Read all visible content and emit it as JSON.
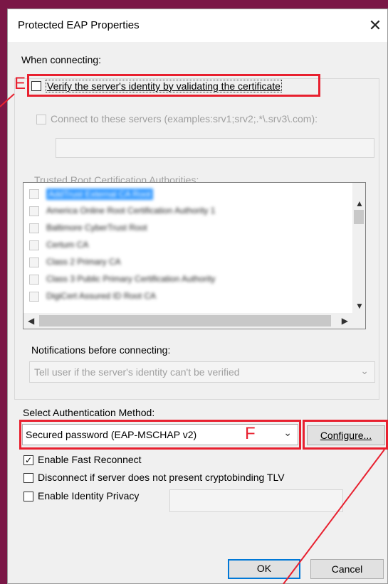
{
  "window": {
    "title": "Protected EAP Properties",
    "close_glyph": "✕"
  },
  "section_connecting": "When connecting:",
  "verify_server": {
    "label": "Verify the server's identity by validating the certificate",
    "checked": false
  },
  "connect_servers": {
    "label": "Connect to these servers (examples:srv1;srv2;.*\\.srv3\\.com):",
    "value": ""
  },
  "trusted_root_label": "Trusted Root Certification Authorities:",
  "trusted_roots": [
    "AddTrust External CA Root",
    "America Online Root Certification Authority 1",
    "Baltimore CyberTrust Root",
    "Certum CA",
    "Class 2 Primary CA",
    "Class 3 Public Primary Certification Authority",
    "DigiCert Assured ID Root CA"
  ],
  "notifications": {
    "label": "Notifications before connecting:",
    "value": "Tell user if the server's identity can't be verified"
  },
  "auth_method": {
    "label": "Select Authentication Method:",
    "value": "Secured password (EAP-MSCHAP v2)",
    "configure_label": "Configure..."
  },
  "options": {
    "fast_reconnect": {
      "label": "Enable Fast Reconnect",
      "checked": true
    },
    "cryptobinding": {
      "label": "Disconnect if server does not present cryptobinding TLV",
      "checked": false
    },
    "identity_privacy": {
      "label": "Enable Identity Privacy",
      "checked": false,
      "value": ""
    }
  },
  "buttons": {
    "ok": "OK",
    "cancel": "Cancel"
  },
  "annotations": {
    "marker_e": "E",
    "marker_f": "F",
    "color": "#e8202f"
  }
}
